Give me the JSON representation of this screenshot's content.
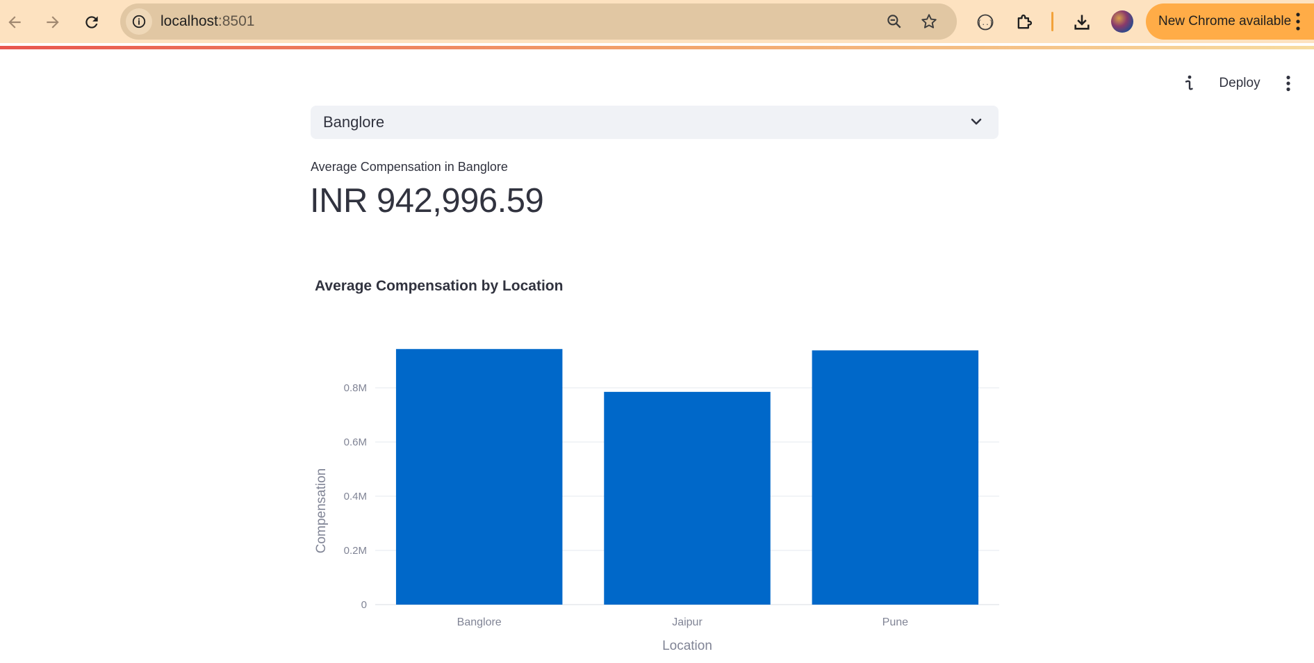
{
  "browser": {
    "url_host": "localhost",
    "url_port": ":8501",
    "update_label": "New Chrome available",
    "colors": {
      "toolbar": "#fde2c0",
      "omnibox": "#e1c7a3",
      "update_pill": "#ffac47"
    },
    "icons": [
      "back-arrow-icon",
      "forward-arrow-icon",
      "reload-icon",
      "site-info-icon",
      "zoom-icon",
      "star-icon",
      "extension-devtools-icon",
      "puzzle-icon",
      "download-icon",
      "avatar",
      "more-vert-icon"
    ]
  },
  "app_header": {
    "deploy_label": "Deploy",
    "icons": [
      "info-icon",
      "more-vert-icon"
    ]
  },
  "location_select": {
    "selected": "Banglore"
  },
  "metric": {
    "label": "Average Compensation in Banglore",
    "value": "INR 942,996.59"
  },
  "chart_data": {
    "type": "bar",
    "title": "Average Compensation by Location",
    "xlabel": "Location",
    "ylabel": "Compensation",
    "categories": [
      "Banglore",
      "Jaipur",
      "Pune"
    ],
    "values": [
      942996.59,
      785000,
      938000
    ],
    "ylim": [
      0,
      1000000
    ],
    "yticks": [
      0,
      200000,
      400000,
      600000,
      800000
    ],
    "ytick_labels": [
      "0",
      "0.2M",
      "0.4M",
      "0.6M",
      "0.8M"
    ],
    "grid": true,
    "bar_color": "#0068c9"
  }
}
